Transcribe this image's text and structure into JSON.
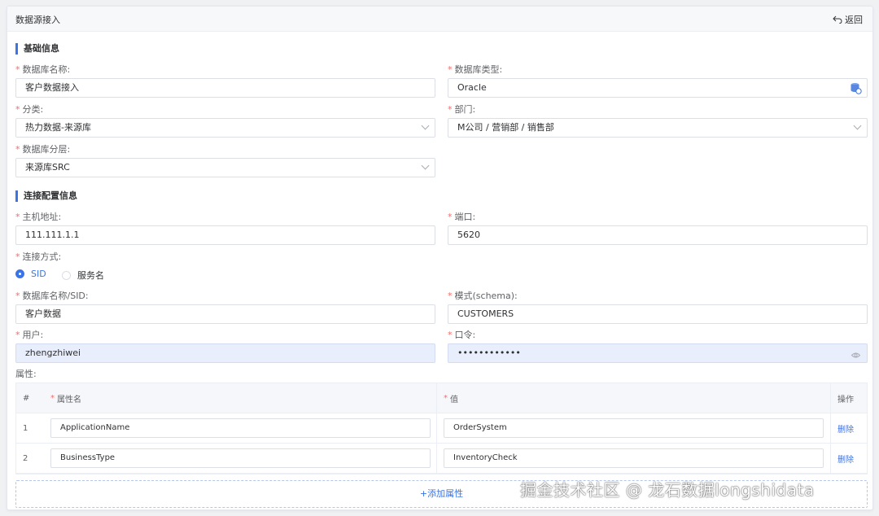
{
  "header": {
    "title": "数据源接入",
    "back_label": "返回"
  },
  "basic": {
    "section_title": "基础信息",
    "db_name": {
      "label": "数据库名称:",
      "value": "客户数据接入"
    },
    "db_type": {
      "label": "数据库类型:",
      "value": "Oracle"
    },
    "category": {
      "label": "分类:",
      "value": "热力数据-来源库"
    },
    "department": {
      "label": "部门:",
      "value": "M公司 / 营销部 / 销售部"
    },
    "layer": {
      "label": "数据库分层:",
      "value": "来源库SRC"
    }
  },
  "connection": {
    "section_title": "连接配置信息",
    "host": {
      "label": "主机地址:",
      "value": "111.111.1.1"
    },
    "port": {
      "label": "端口:",
      "value": "5620"
    },
    "mode": {
      "label": "连接方式:",
      "options": [
        "SID",
        "服务名"
      ],
      "selected": "SID"
    },
    "sid": {
      "label": "数据库名称/SID:",
      "value": "客户数据"
    },
    "schema": {
      "label": "模式(schema):",
      "value": "CUSTOMERS"
    },
    "user": {
      "label": "用户:",
      "value": "zhengzhiwei"
    },
    "password": {
      "label": "口令:",
      "value": "••••••••••••"
    }
  },
  "properties": {
    "label": "属性:",
    "columns": [
      "#",
      "属性名",
      "值",
      "操作"
    ],
    "rows": [
      {
        "index": "1",
        "name": "ApplicationName",
        "value": "OrderSystem",
        "action": "删除"
      },
      {
        "index": "2",
        "name": "BusinessType",
        "value": "InventoryCheck",
        "action": "删除"
      }
    ],
    "add_label": "+添加属性"
  },
  "watermark": "掘金技术社区 @ 龙石数据longshidata",
  "colors": {
    "accent": "#3b74e6",
    "required": "#f56c6c",
    "filled_bg": "#e8eefb"
  }
}
